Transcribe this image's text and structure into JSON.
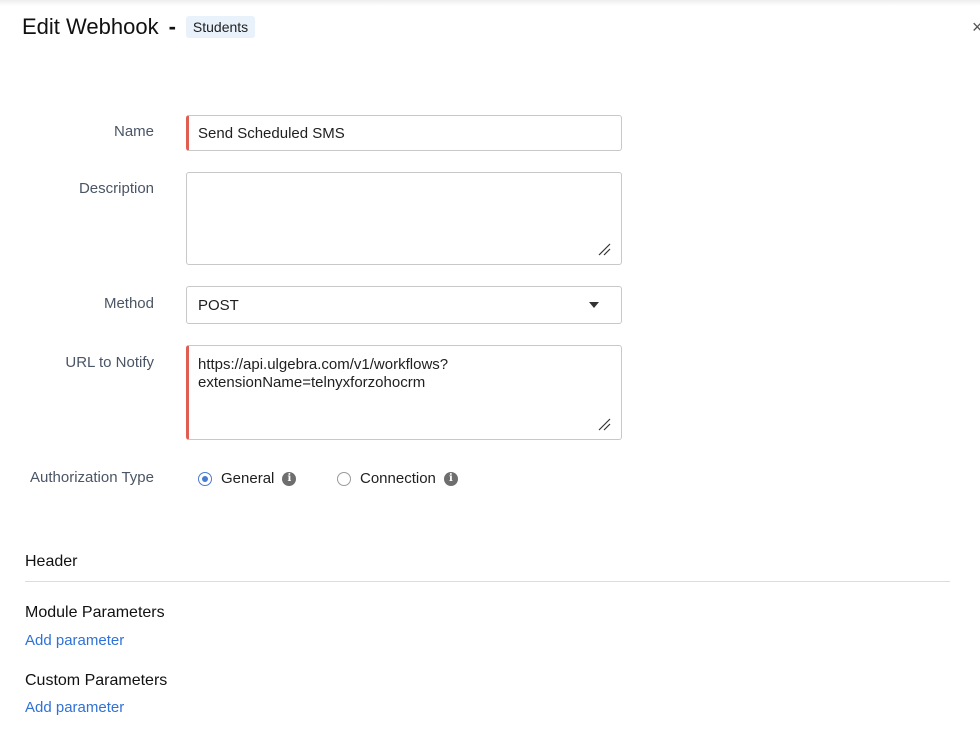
{
  "header": {
    "title": "Edit Webhook",
    "separator": "-",
    "module": "Students"
  },
  "form": {
    "name": {
      "label": "Name",
      "value": "Send Scheduled SMS"
    },
    "description": {
      "label": "Description",
      "value": ""
    },
    "method": {
      "label": "Method",
      "value": "POST"
    },
    "url": {
      "label": "URL to Notify",
      "value_line1": "https://api.ulgebra.com/v1/workflows?",
      "value_line2": "extensionName=telnyxforzohocrm"
    },
    "authorization": {
      "label": "Authorization Type",
      "options": [
        {
          "label": "General",
          "selected": true
        },
        {
          "label": "Connection",
          "selected": false
        }
      ]
    }
  },
  "sections": {
    "header_title": "Header",
    "module_params_title": "Module Parameters",
    "module_params_link": "Add parameter",
    "custom_params_title": "Custom Parameters",
    "custom_params_link": "Add parameter"
  },
  "colors": {
    "required": "#e05d52",
    "link": "#2f72d6",
    "radio": "#4a7bd0"
  }
}
